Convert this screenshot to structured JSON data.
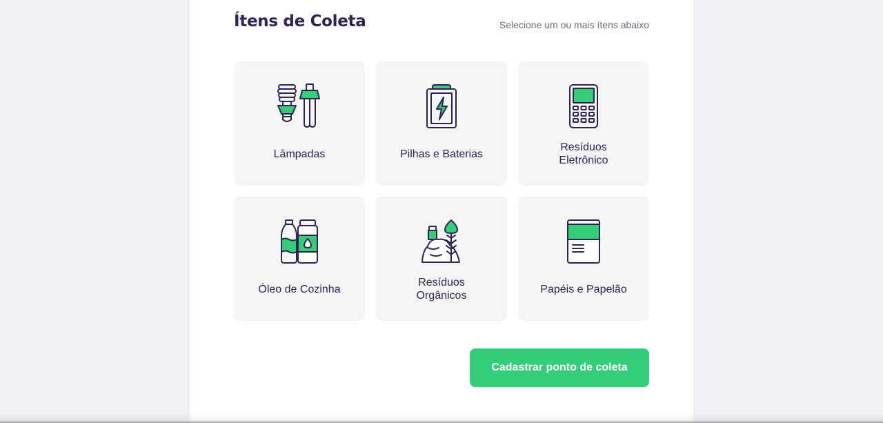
{
  "section": {
    "title": "Ítens de Coleta",
    "hint": "Selecione um ou mais ítens abaixo"
  },
  "items": [
    {
      "label": "Lâmpadas",
      "icon": "lamp-icon"
    },
    {
      "label": "Pilhas e Baterias",
      "icon": "battery-icon"
    },
    {
      "label": "Resíduos Eletrônico",
      "icon": "electronic-device-icon"
    },
    {
      "label": "Óleo de Cozinha",
      "icon": "oil-bottle-icon"
    },
    {
      "label": "Resíduos Orgânicos",
      "icon": "organic-waste-icon"
    },
    {
      "label": "Papéis e Papelão",
      "icon": "paper-icon"
    }
  ],
  "form": {
    "submit_label": "Cadastrar ponto de coleta"
  },
  "colors": {
    "primary": "#34cb79",
    "title": "#322153",
    "text": "#6c6c80",
    "tile_background": "#f5f5f5",
    "page_background": "#f0f0f5"
  }
}
